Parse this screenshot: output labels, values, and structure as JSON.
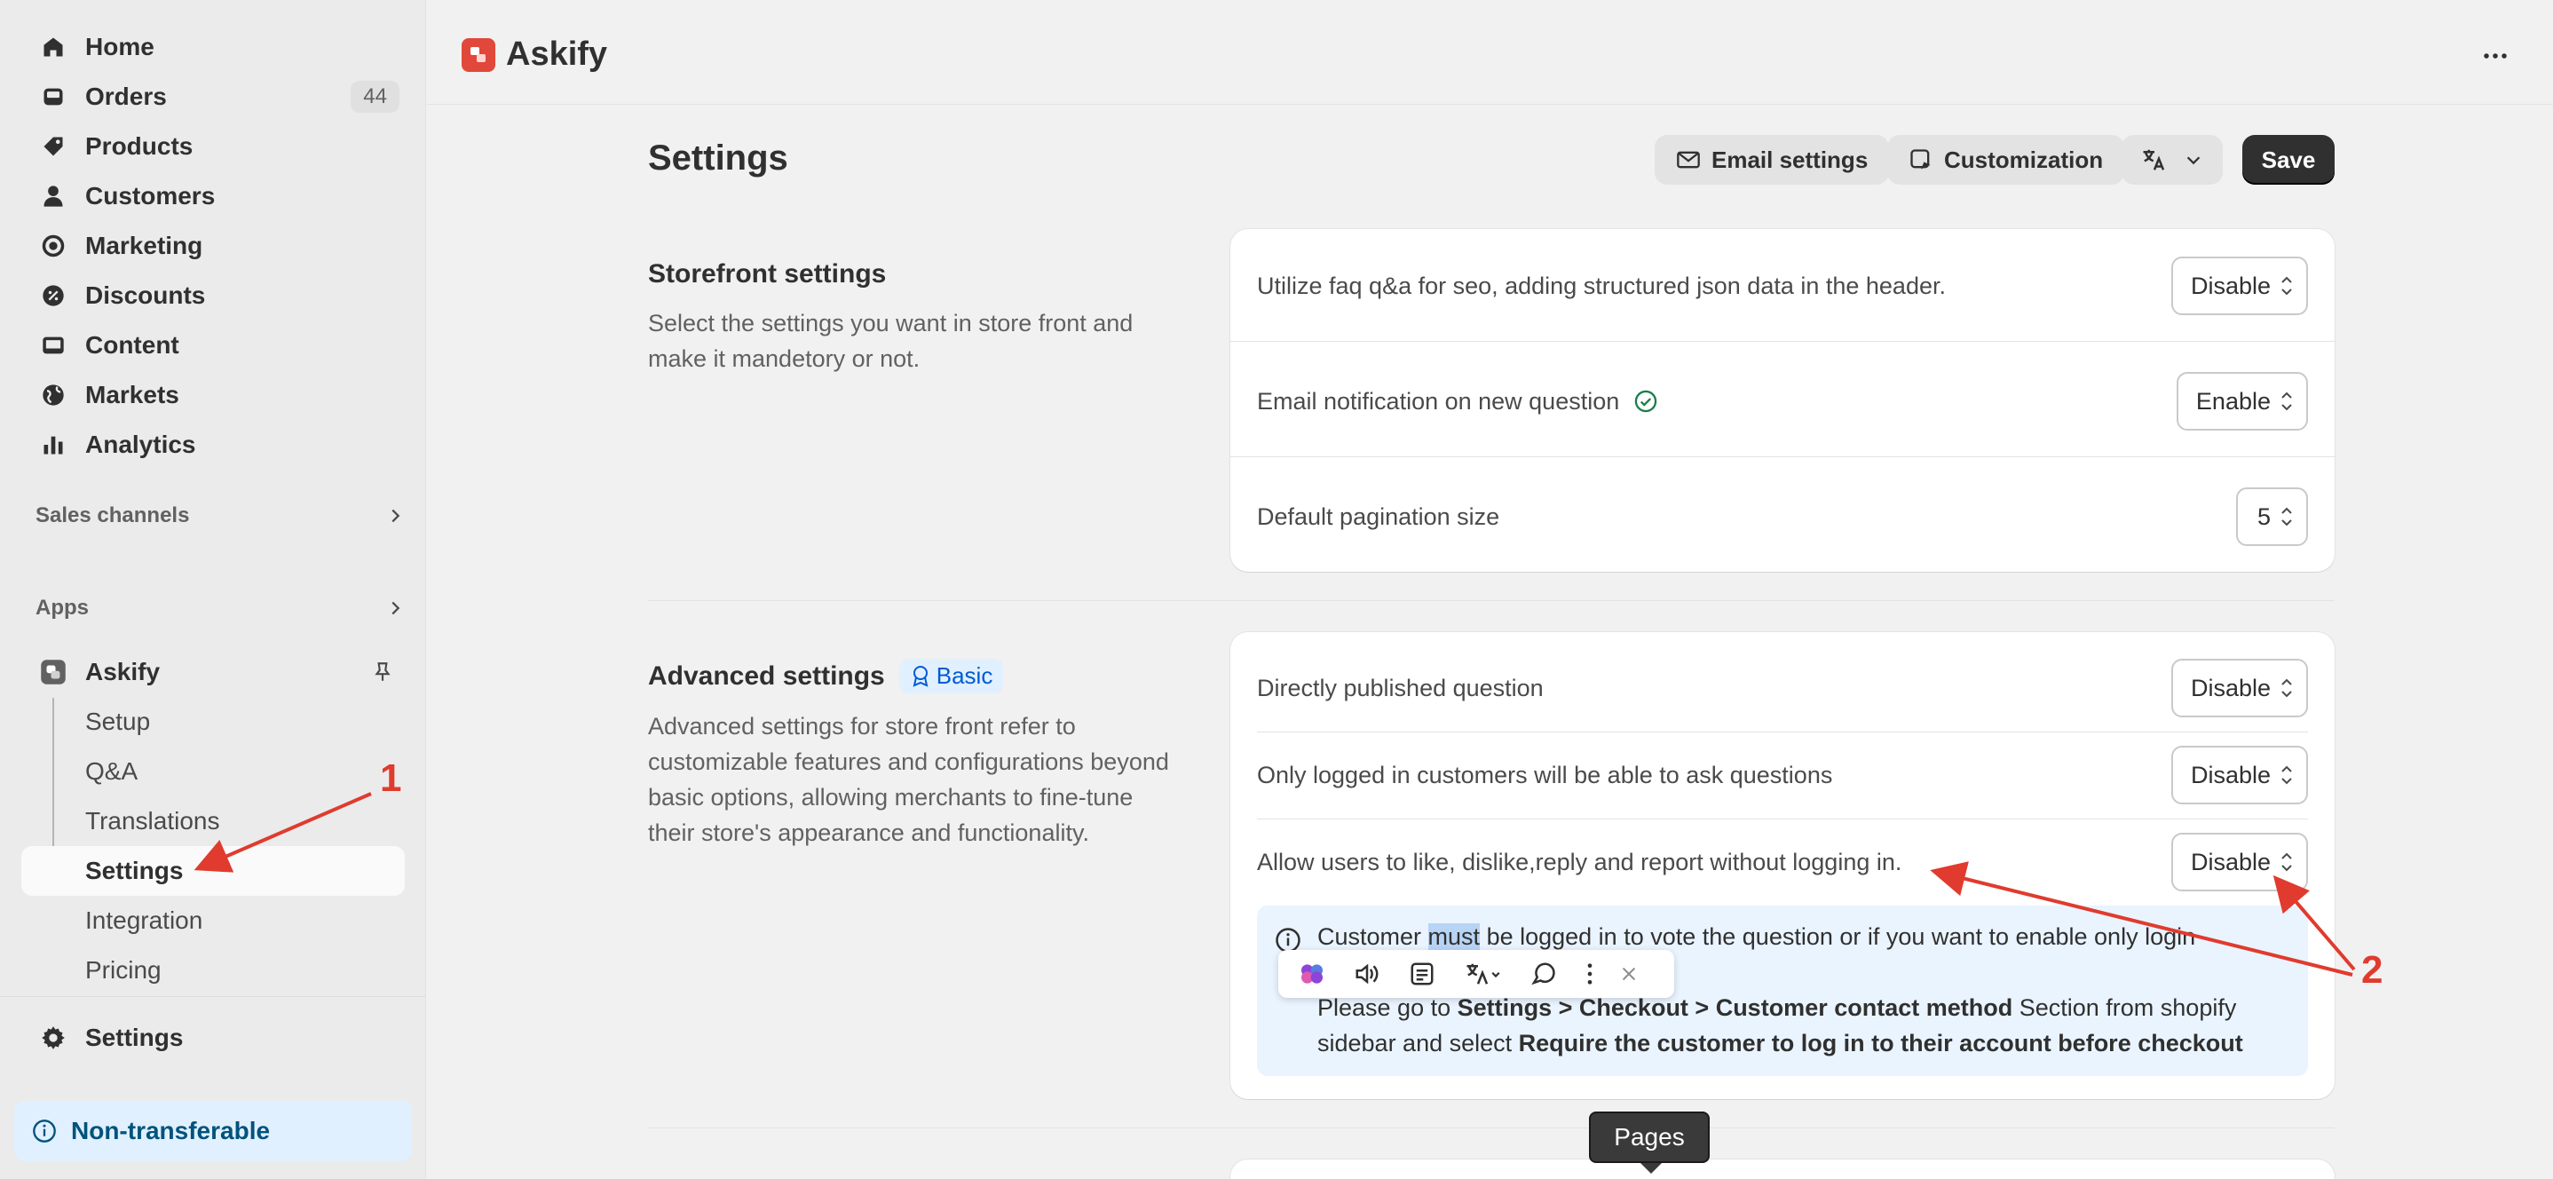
{
  "sidebar": {
    "nav": [
      {
        "label": "Home",
        "icon": "home-icon"
      },
      {
        "label": "Orders",
        "icon": "inbox-icon",
        "badge": "44"
      },
      {
        "label": "Products",
        "icon": "tag-icon"
      },
      {
        "label": "Customers",
        "icon": "person-icon"
      },
      {
        "label": "Marketing",
        "icon": "target-icon"
      },
      {
        "label": "Discounts",
        "icon": "discount-icon"
      },
      {
        "label": "Content",
        "icon": "image-icon"
      },
      {
        "label": "Markets",
        "icon": "globe-icon"
      },
      {
        "label": "Analytics",
        "icon": "bar-chart-icon"
      }
    ],
    "sales_channels": "Sales channels",
    "apps": "Apps",
    "app_name": "Askify",
    "app_sub": [
      "Setup",
      "Q&A",
      "Translations",
      "Settings",
      "Integration",
      "Pricing"
    ],
    "settings": "Settings",
    "non_transferable": "Non-transferable"
  },
  "topbar": {
    "app_title": "Askify"
  },
  "header": {
    "title": "Settings",
    "email_settings": "Email settings",
    "customization": "Customization",
    "save": "Save"
  },
  "storefront": {
    "title": "Storefront settings",
    "description": "Select the settings you want in store front and make it mandetory or not.",
    "rows": [
      {
        "label": "Utilize faq q&a for seo, adding structured json data in the header.",
        "value": "Disable"
      },
      {
        "label": "Email notification on new question",
        "value": "Enable"
      },
      {
        "label": "Default pagination size",
        "value": "5"
      }
    ]
  },
  "advanced": {
    "title": "Advanced settings",
    "badge": "Basic",
    "description": "Advanced settings for store front refer to customizable features and configurations beyond basic options, allowing merchants to fine-tune their store's appearance and functionality.",
    "rows": [
      {
        "label": "Directly published question",
        "value": "Disable"
      },
      {
        "label": "Only logged in customers will be able to ask questions",
        "value": "Disable"
      },
      {
        "label": "Allow users to like, dislike,reply and report without logging in.",
        "value": "Disable"
      }
    ],
    "info": {
      "l1a": "Customer ",
      "l1b": "must",
      "l1c": " be logged in to vote the question or if you want to enable only login",
      "l2a": "Please go to ",
      "l2b": "Settings > Checkout > Customer contact method",
      "l2c": " Section from shopify",
      "l3a": "sidebar and select ",
      "l3b": "Require the customer to log in to their account before checkout"
    }
  },
  "tooltip": {
    "pages": "Pages"
  },
  "annotations": {
    "one": "1",
    "two": "2"
  },
  "colors": {
    "accent": "#e03b2e",
    "info_bg": "#eaf4ff",
    "primary_button": "#303030"
  }
}
